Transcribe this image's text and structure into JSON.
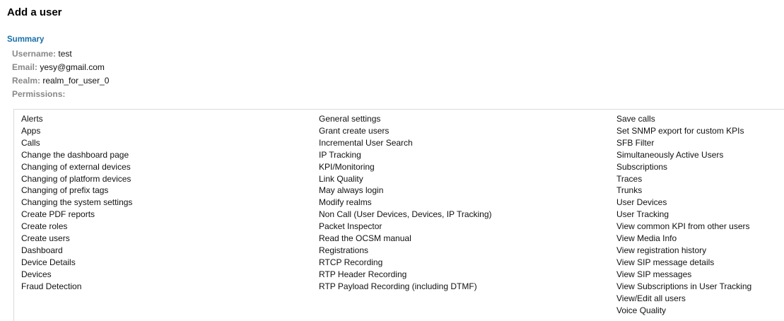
{
  "page": {
    "title": "Add a user"
  },
  "summary": {
    "heading": "Summary",
    "username_label": "Username:",
    "username": "test",
    "email_label": "Email:",
    "email": "yesy@gmail.com",
    "realm_label": "Realm:",
    "realm": "realm_for_user_0",
    "permissions_label": "Permissions:"
  },
  "permissions": {
    "col1": [
      "Alerts",
      "Apps",
      "Calls",
      "Change the dashboard page",
      "Changing of external devices",
      "Changing of platform devices",
      "Changing of prefix tags",
      "Changing the system settings",
      "Create PDF reports",
      "Create roles",
      "Create users",
      "Dashboard",
      "Device Details",
      "Devices",
      "Fraud Detection"
    ],
    "col2": [
      "General settings",
      "Grant create users",
      "Incremental User Search",
      "IP Tracking",
      "KPI/Monitoring",
      "Link Quality",
      "May always login",
      "Modify realms",
      "Non Call (User Devices, Devices, IP Tracking)",
      "Packet Inspector",
      "Read the OCSM manual",
      "Registrations",
      "RTCP Recording",
      "RTP Header Recording",
      "RTP Payload Recording (including DTMF)"
    ],
    "col3": [
      "Save calls",
      "Set SNMP export for custom KPIs",
      "SFB Filter",
      "Simultaneously Active Users",
      "Subscriptions",
      "Traces",
      "Trunks",
      "User Devices",
      "User Tracking",
      "View common KPI from other users",
      "View Media Info",
      "View registration history",
      "View SIP message details",
      "View SIP messages",
      "View Subscriptions in User Tracking",
      "View/Edit all users",
      "Voice Quality"
    ]
  }
}
